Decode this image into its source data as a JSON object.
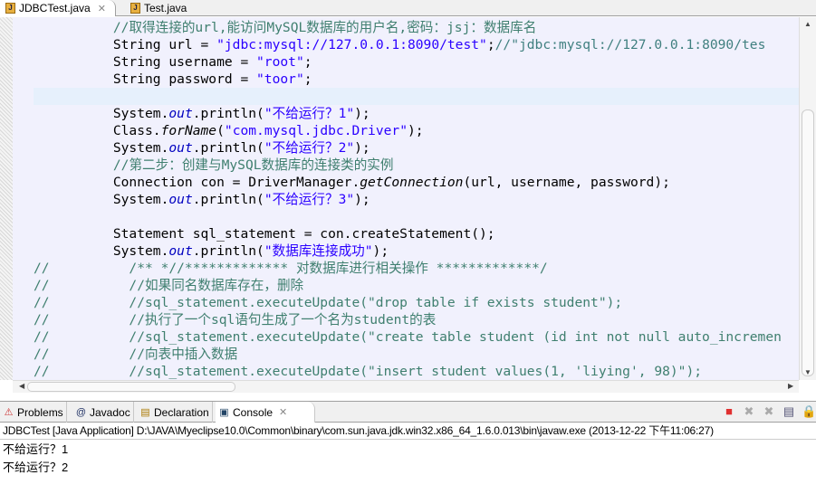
{
  "editor_tabs": [
    {
      "label": "JDBCTest.java",
      "active": true
    },
    {
      "label": "Test.java",
      "active": false
    }
  ],
  "code_lines": [
    {
      "p": "",
      "seg": [
        [
          "          ",
          ""
        ],
        [
          "//取得连接的url,能访问MySQL数据库的用户名,密码：jsj：数据库名",
          "c"
        ]
      ]
    },
    {
      "p": "",
      "seg": [
        [
          "          String url = ",
          ""
        ],
        [
          "\"jdbc:mysql://127.0.0.1:8090/test\"",
          "s"
        ],
        [
          ";",
          ""
        ],
        [
          "//\"jdbc:mysql://127.0.0.1:8090/tes",
          "cs"
        ]
      ]
    },
    {
      "p": "",
      "seg": [
        [
          "          String username = ",
          ""
        ],
        [
          "\"root\"",
          "s"
        ],
        [
          ";",
          ""
        ]
      ]
    },
    {
      "p": "",
      "seg": [
        [
          "          String password = ",
          ""
        ],
        [
          "\"toor\"",
          "s"
        ],
        [
          ";",
          ""
        ]
      ]
    },
    {
      "p": "",
      "seg": []
    },
    {
      "p": "",
      "seg": [
        [
          "          System.",
          ""
        ],
        [
          "out",
          "o"
        ],
        [
          ".println(",
          ""
        ],
        [
          "\"不给运行？1\"",
          "s"
        ],
        [
          ");",
          ""
        ]
      ]
    },
    {
      "p": "",
      "seg": [
        [
          "          Class.",
          ""
        ],
        [
          "forName",
          "m"
        ],
        [
          "(",
          ""
        ],
        [
          "\"com.mysql.jdbc.Driver\"",
          "s"
        ],
        [
          ");",
          ""
        ]
      ]
    },
    {
      "p": "",
      "seg": [
        [
          "          System.",
          ""
        ],
        [
          "out",
          "o"
        ],
        [
          ".println(",
          ""
        ],
        [
          "\"不给运行？2\"",
          "s"
        ],
        [
          ");",
          ""
        ]
      ]
    },
    {
      "p": "",
      "seg": [
        [
          "          ",
          ""
        ],
        [
          "//第二步：创建与MySQL数据库的连接类的实例",
          "c"
        ]
      ]
    },
    {
      "p": "",
      "seg": [
        [
          "          Connection con = DriverManager.",
          ""
        ],
        [
          "getConnection",
          "m"
        ],
        [
          "(url, username, password);",
          ""
        ]
      ]
    },
    {
      "p": "",
      "seg": [
        [
          "          System.",
          ""
        ],
        [
          "out",
          "o"
        ],
        [
          ".println(",
          ""
        ],
        [
          "\"不给运行？3\"",
          "s"
        ],
        [
          ");",
          ""
        ]
      ]
    },
    {
      "p": "",
      "seg": []
    },
    {
      "p": "",
      "seg": [
        [
          "          Statement sql_statement = con.createStatement();",
          ""
        ]
      ]
    },
    {
      "p": "",
      "seg": [
        [
          "          System.",
          ""
        ],
        [
          "out",
          "o"
        ],
        [
          ".println(",
          ""
        ],
        [
          "\"数据库连接成功\"",
          "s"
        ],
        [
          ");",
          ""
        ]
      ]
    },
    {
      "p": "",
      "seg": [
        [
          "//          /** *//************* 对数据库进行相关操作 *************/",
          "c"
        ]
      ]
    },
    {
      "p": "",
      "seg": [
        [
          "//          //如果同名数据库存在，删除",
          "c"
        ]
      ]
    },
    {
      "p": "",
      "seg": [
        [
          "//          //sql_statement.executeUpdate(\"drop table if exists student\");",
          "c"
        ]
      ]
    },
    {
      "p": "",
      "seg": [
        [
          "//          //执行了一个sql语句生成了一个名为student的表",
          "c"
        ]
      ]
    },
    {
      "p": "",
      "seg": [
        [
          "//          //sql_statement.executeUpdate(\"create table student (id int not null auto_incremen",
          "c"
        ]
      ]
    },
    {
      "p": "",
      "seg": [
        [
          "//          //向表中插入数据",
          "c"
        ]
      ]
    },
    {
      "p": "",
      "seg": [
        [
          "//          //sql_statement.executeUpdate(\"insert student values(1, 'liying', 98)\");",
          "c"
        ]
      ]
    }
  ],
  "panel_tabs": [
    {
      "label": "Problems",
      "icon": "problems-icon"
    },
    {
      "label": "Javadoc",
      "icon": "at-icon"
    },
    {
      "label": "Declaration",
      "icon": "declaration-icon"
    },
    {
      "label": "Console",
      "icon": "console-icon",
      "active": true
    }
  ],
  "console": {
    "header": "JDBCTest [Java Application] D:\\JAVA\\Myeclipse10.0\\Common\\binary\\com.sun.java.jdk.win32.x86_64_1.6.0.013\\bin\\javaw.exe (2013-12-22 下午11:06:27)",
    "output": [
      "不给运行？1",
      "不给运行？2"
    ]
  },
  "colors": {
    "string": "#2a00ff",
    "comment": "#3f7f6f",
    "static_field": "#0000c0",
    "terminate": "#e03030"
  }
}
